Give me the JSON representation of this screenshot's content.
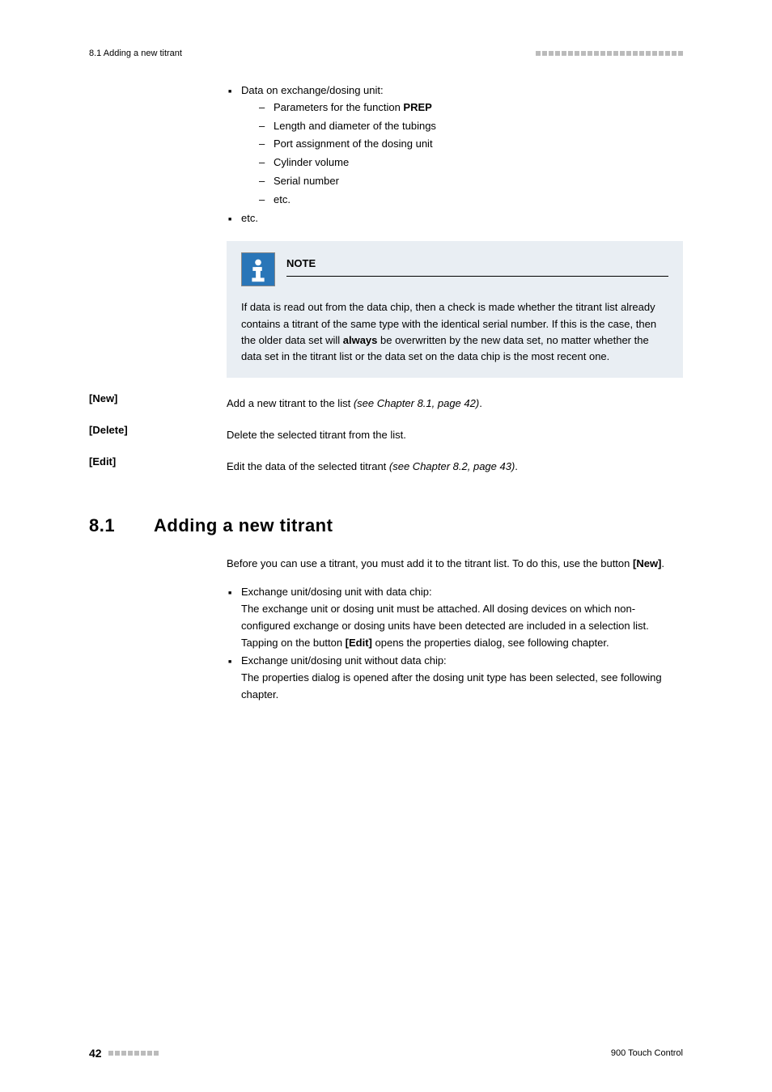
{
  "header": {
    "breadcrumb": "8.1 Adding a new titrant"
  },
  "top_list": {
    "item_main": "Data on exchange/dosing unit:",
    "sub": [
      {
        "prefix": "Parameters for the function ",
        "bold": "PREP"
      },
      {
        "text": "Length and diameter of the tubings"
      },
      {
        "text": "Port assignment of the dosing unit"
      },
      {
        "text": "Cylinder volume"
      },
      {
        "text": "Serial number"
      },
      {
        "text": "etc."
      }
    ],
    "item_etc": "etc."
  },
  "note": {
    "title": "NOTE",
    "body_pre": "If data is read out from the data chip, then a check is made whether the titrant list already contains a titrant of the same type with the identical serial number. If this is the case, then the older data set will ",
    "body_bold": "always",
    "body_post": " be overwritten by the new data set, no matter whether the data set in the titrant list or the data set on the data chip is the most recent one."
  },
  "rows": [
    {
      "label": "[New]",
      "pre": "Add a new titrant to the list ",
      "italic": "(see Chapter 8.1, page 42)",
      "post": "."
    },
    {
      "label": "[Delete]",
      "pre": "Delete the selected titrant from the list.",
      "italic": "",
      "post": ""
    },
    {
      "label": "[Edit]",
      "pre": "Edit the data of the selected titrant ",
      "italic": "(see Chapter 8.2, page 43)",
      "post": "."
    }
  ],
  "section": {
    "num": "8.1",
    "title": "Adding a new titrant",
    "intro_pre": "Before you can use a titrant, you must add it to the titrant list. To do this, use the button ",
    "intro_bold": "[New]",
    "intro_post": ".",
    "bullets": [
      {
        "line1": "Exchange unit/dosing unit with data chip:",
        "body_pre": "The exchange unit or dosing unit must be attached. All dosing devices on which non-configured exchange or dosing units have been detected are included in a selection list. Tapping on the button ",
        "body_bold": "[Edit]",
        "body_post": " opens the properties dialog, see following chapter."
      },
      {
        "line1": "Exchange unit/dosing unit without data chip:",
        "body_pre": "The properties dialog is opened after the dosing unit type has been selected, see following chapter.",
        "body_bold": "",
        "body_post": ""
      }
    ]
  },
  "footer": {
    "page": "42",
    "product": "900 Touch Control"
  }
}
